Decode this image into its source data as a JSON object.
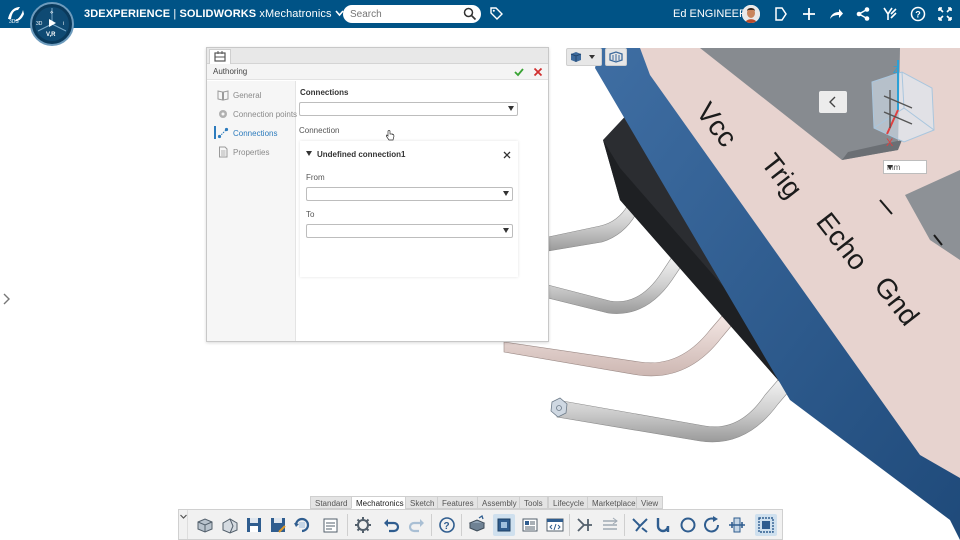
{
  "topbar": {
    "brand_bold": "3DEXPERIENCE",
    "brand_sep": " | ",
    "brand_app_bold": "SOLIDWORKS",
    "brand_app": " xMechatronics",
    "compass_role": "V,R",
    "search_placeholder": "Search",
    "user_name": "Ed ENGINEER",
    "colors": {
      "bar": "#005386",
      "text": "#ffffff"
    }
  },
  "panel": {
    "title": "Authoring",
    "nav": [
      {
        "label": "General",
        "icon": "book-icon"
      },
      {
        "label": "Connection points",
        "icon": "connection-point-icon"
      },
      {
        "label": "Connections",
        "icon": "connections-icon",
        "active": true
      },
      {
        "label": "Properties",
        "icon": "document-icon"
      }
    ],
    "connections_title": "Connections",
    "connections_value": "",
    "connection_label": "Connection",
    "connection_item": {
      "name": "Undefined connection1",
      "from_label": "From",
      "from_value": "",
      "to_label": "To",
      "to_value": ""
    },
    "colors": {
      "active": "#2c7bbd",
      "ok": "#3aa335",
      "cancel": "#d03030"
    }
  },
  "viewport": {
    "units_value": "mm",
    "part_labels": [
      "Vcc",
      "Trig",
      "Echo",
      "Gnd"
    ],
    "colors": {
      "board": "#2f5d8f",
      "top_face": "#e7d3cf",
      "body": "#2f3236"
    }
  },
  "actionbar": {
    "tabs": [
      {
        "label": "Standard"
      },
      {
        "label": "Mechatronics",
        "active": true
      },
      {
        "label": "Sketch"
      },
      {
        "label": "Features"
      },
      {
        "label": "Assembly"
      },
      {
        "label": "Tools"
      },
      {
        "label": "Lifecycle"
      },
      {
        "label": "Marketplace"
      },
      {
        "label": "View"
      }
    ]
  }
}
